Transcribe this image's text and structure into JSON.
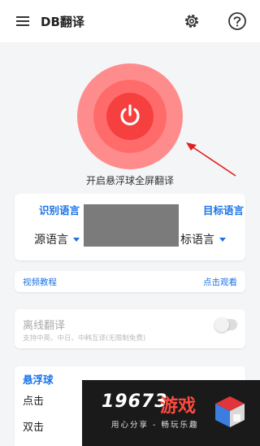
{
  "appbar": {
    "title": "DB翻译",
    "icons": [
      "menu-icon",
      "gear-icon",
      "help-icon"
    ]
  },
  "power": {
    "caption": "开启悬浮球全屏翻译",
    "colors": {
      "outer": "#ff8c8c",
      "middle": "#ff6b6b",
      "inner": "#f5403f",
      "annotation_arrow": "#e02020"
    }
  },
  "language": {
    "source_title": "识别语言",
    "target_title": "目标语言",
    "source_value": "源语言",
    "target_value": "标语言"
  },
  "video": {
    "label": "视频教程",
    "link": "点击观看"
  },
  "offline": {
    "title": "离线翻译",
    "subtitle": "支持中英、中日、中韩互译(无限制免费)",
    "enabled": false
  },
  "floating_ball": {
    "title": "悬浮球",
    "items": [
      "点击",
      "双击"
    ]
  },
  "watermark": {
    "brand_digits": "19673",
    "brand_word": "游戏",
    "slogan": "用心分享 - 畅玩乐趣"
  },
  "accent_color": "#1a73e8"
}
